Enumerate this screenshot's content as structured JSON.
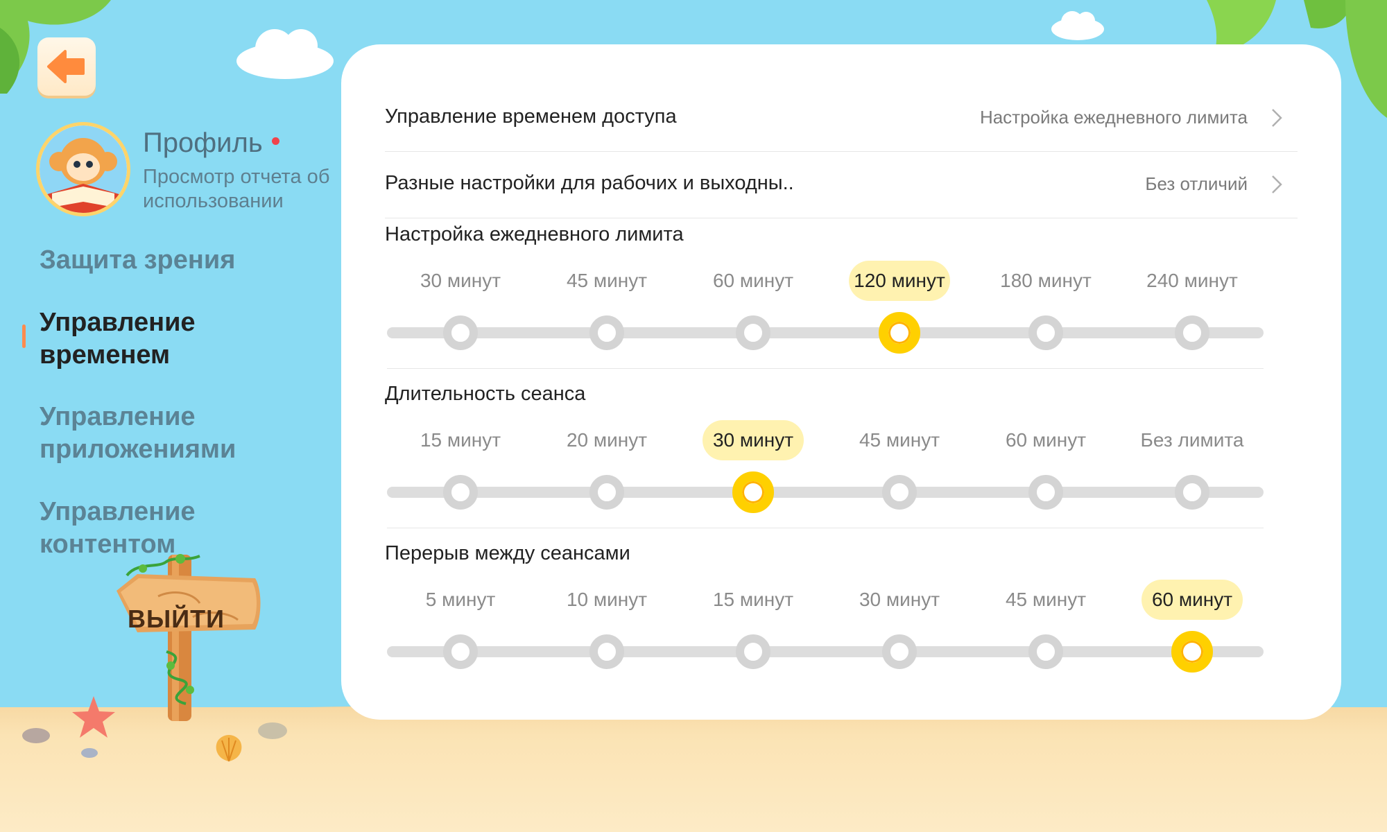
{
  "sidebar": {
    "back_icon": "back-arrow-icon",
    "profile": {
      "title": "Профиль",
      "subtitle": "Просмотр отчета об использовании",
      "avatar_icon": "monkey-reading-avatar"
    },
    "nav": [
      {
        "label": "Защита зрения",
        "active": false
      },
      {
        "label": "Управление временем",
        "active": true
      },
      {
        "label": "Управление приложениями",
        "active": false
      },
      {
        "label": "Управление контентом",
        "active": false
      }
    ],
    "exit_label": "ВЫЙТИ"
  },
  "settings": {
    "rows": [
      {
        "label": "Управление временем доступа",
        "value": "Настройка ежедневного лимита"
      },
      {
        "label": "Разные настройки для рабочих и выходны..",
        "value": "Без отличий"
      }
    ],
    "sections": [
      {
        "title": "Настройка ежедневного лимита",
        "options": [
          "30 минут",
          "45 минут",
          "60 минут",
          "120 минут",
          "180 минут",
          "240 минут"
        ],
        "selected_index": 3
      },
      {
        "title": "Длительность сеанса",
        "options": [
          "15 минут",
          "20 минут",
          "30 минут",
          "45 минут",
          "60 минут",
          "Без лимита"
        ],
        "selected_index": 2
      },
      {
        "title": "Перерыв между сеансами",
        "options": [
          "5 минут",
          "10 минут",
          "15 минут",
          "30 минут",
          "45 минут",
          "60 минут"
        ],
        "selected_index": 5
      }
    ]
  },
  "colors": {
    "sky": "#8adbf3",
    "accent": "#ffd000",
    "selected_bg": "#fff2b0",
    "back_button": "#ff8b3d"
  }
}
